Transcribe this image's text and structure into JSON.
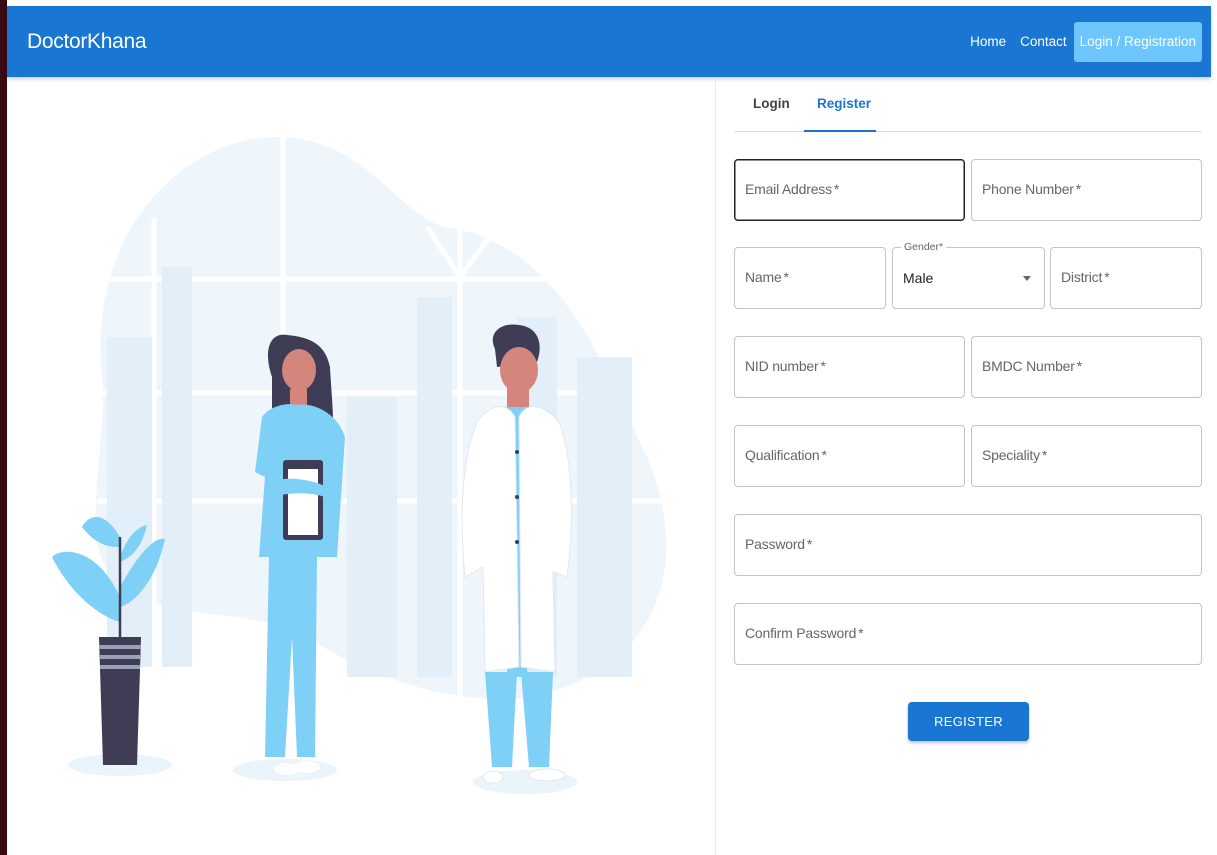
{
  "appbar": {
    "brand": "DoctorKhana",
    "nav": {
      "home": "Home",
      "contact": "Contact",
      "login": "Login / Registration"
    }
  },
  "tabs": {
    "login": "Login",
    "register": "Register",
    "active": "Register"
  },
  "form": {
    "email": {
      "label": "Email Address",
      "required": "*"
    },
    "phone": {
      "label": "Phone Number",
      "required": "*"
    },
    "name": {
      "label": "Name",
      "required": "*"
    },
    "gender": {
      "label": "Gender",
      "required": "*",
      "value": "Male"
    },
    "district": {
      "label": "District",
      "required": "*"
    },
    "nid": {
      "label": "NID number",
      "required": "*"
    },
    "bmdc": {
      "label": "BMDC Number",
      "required": "*"
    },
    "qualification": {
      "label": "Qualification",
      "required": "*"
    },
    "speciality": {
      "label": "Speciality",
      "required": "*"
    },
    "password": {
      "label": "Password",
      "required": "*"
    },
    "confirm_password": {
      "label": "Confirm Password",
      "required": "*"
    },
    "submit": "REGISTER"
  },
  "colors": {
    "primary": "#1976d2",
    "nav_highlight": "#6ec6ff",
    "scrubs": "#7fd0f7",
    "dark": "#3f3d56"
  }
}
